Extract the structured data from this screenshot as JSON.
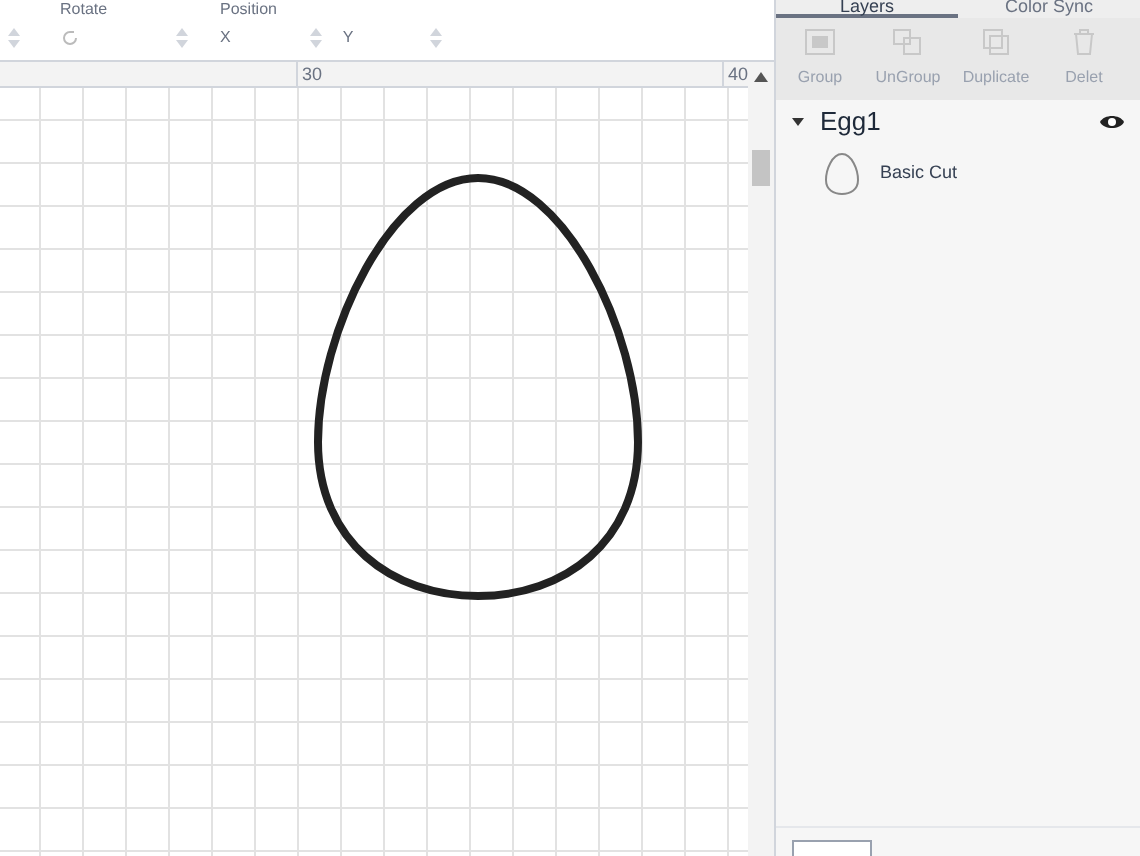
{
  "toolbar": {
    "rotate": {
      "label": "Rotate"
    },
    "position": {
      "label": "Position",
      "x_label": "X",
      "y_label": "Y"
    }
  },
  "ruler": {
    "ticks": [
      "30",
      "40"
    ]
  },
  "panel": {
    "tabs": [
      {
        "label": "Layers",
        "selected": true
      },
      {
        "label": "Color Sync",
        "selected": false
      }
    ],
    "actions": [
      {
        "kind": "group",
        "label": "Group",
        "disabled": true
      },
      {
        "kind": "ungroup",
        "label": "UnGroup",
        "disabled": true
      },
      {
        "kind": "duplicate",
        "label": "Duplicate",
        "disabled": true
      },
      {
        "kind": "delete",
        "label": "Delet",
        "disabled": true
      }
    ],
    "layers": [
      {
        "name": "Egg1",
        "expanded": true,
        "visible": true,
        "children": [
          {
            "name": "Basic Cut"
          }
        ]
      }
    ]
  }
}
